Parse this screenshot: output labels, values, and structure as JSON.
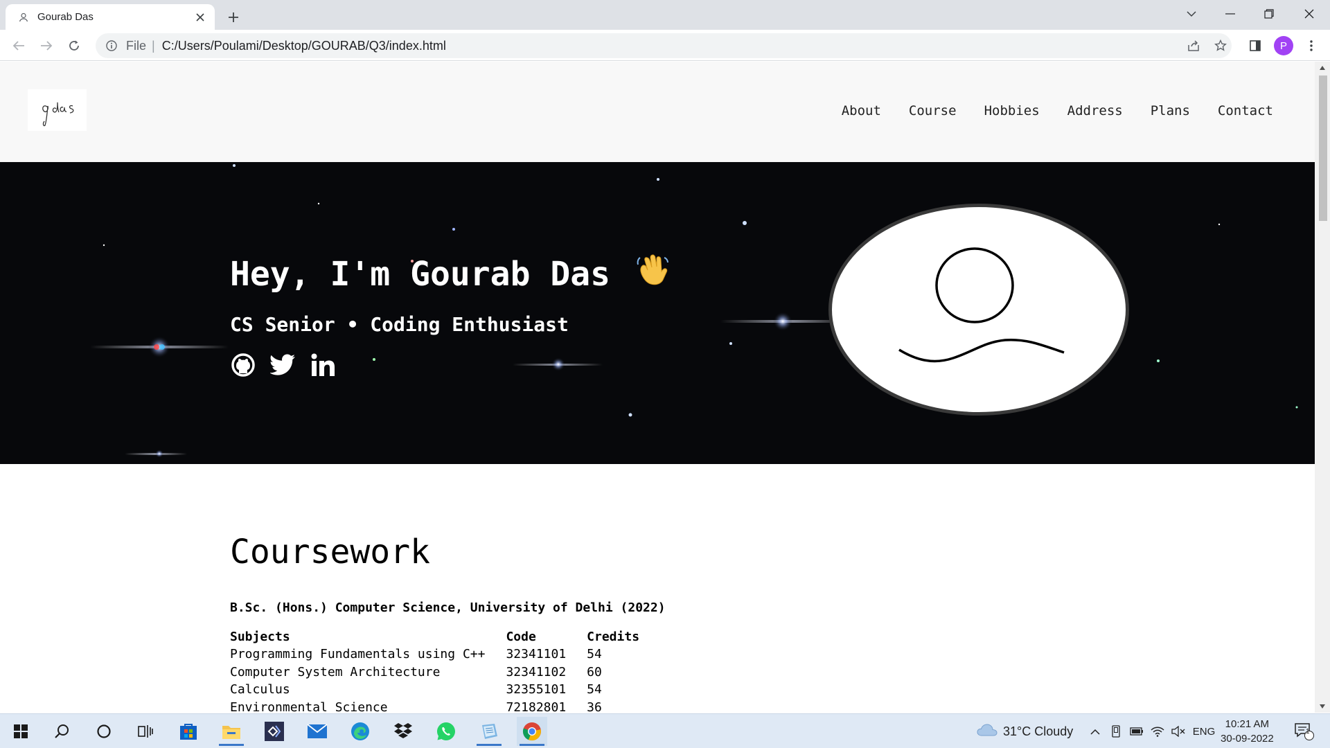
{
  "browser": {
    "tab_title": "Gourab Das",
    "url_scheme": "File",
    "url": "C:/Users/Poulami/Desktop/GOURAB/Q3/index.html",
    "profile_initial": "P"
  },
  "site": {
    "logo_text": "g das",
    "nav": [
      "About",
      "Course",
      "Hobbies",
      "Address",
      "Plans",
      "Contact"
    ],
    "hero": {
      "title": "Hey, I'm Gourab Das",
      "wave_emoji": "👋",
      "subtitle": "CS Senior • Coding Enthusiast",
      "socials": [
        "github-icon",
        "twitter-icon",
        "linkedin-icon"
      ]
    },
    "coursework": {
      "heading": "Coursework",
      "degree": "B.Sc. (Hons.) Computer Science, University of Delhi (2022)",
      "columns": [
        "Subjects",
        "Code",
        "Credits"
      ],
      "rows": [
        [
          "Programming Fundamentals using C++",
          "32341101",
          "54"
        ],
        [
          "Computer System Architecture",
          "32341102",
          "60"
        ],
        [
          "Calculus",
          "32355101",
          "54"
        ],
        [
          "Environmental Science",
          "72182801",
          "36"
        ]
      ]
    }
  },
  "taskbar": {
    "weather": "31°C  Cloudy",
    "language": "ENG",
    "time": "10:21 AM",
    "date": "30-09-2022",
    "notification_count": "1",
    "apps": [
      "start-icon",
      "search-icon",
      "cortana-icon",
      "task-view-icon",
      "store-icon",
      "file-explorer-icon",
      "visual-studio-icon",
      "mail-icon",
      "edge-icon",
      "dropbox-icon",
      "whatsapp-icon",
      "notepad-icon",
      "chrome-icon"
    ]
  }
}
